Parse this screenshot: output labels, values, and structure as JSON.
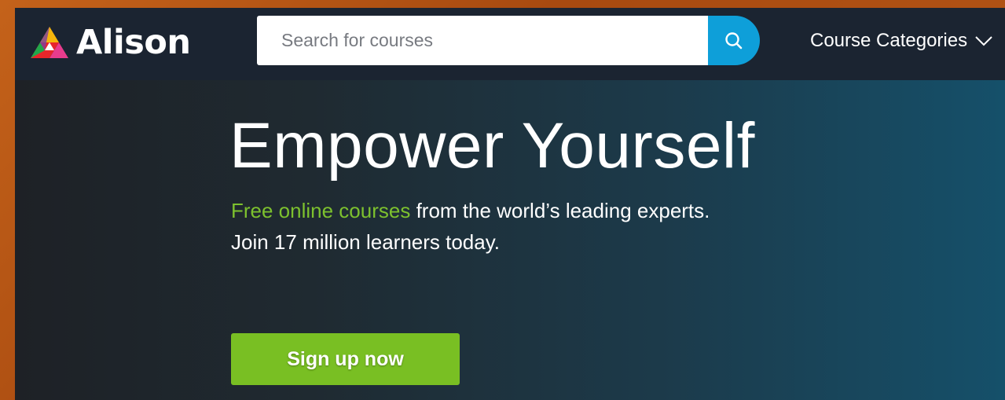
{
  "header": {
    "logo_text": "Alison",
    "logo_icon": "alison-logo-icon",
    "search": {
      "placeholder": "Search for courses",
      "value": "",
      "button_icon": "search-icon"
    },
    "categories_label": "Course Categories",
    "categories_icon": "chevron-down-icon"
  },
  "hero": {
    "title": "Empower Yourself",
    "subtitle_accent": "Free online courses",
    "subtitle_rest": " from the world’s leading experts.",
    "subtitle_line2": "Join 17 million learners today.",
    "cta_label": "Sign up now"
  },
  "colors": {
    "accent_green": "#79bf23",
    "search_blue": "#0e9fd9",
    "header_bg": "#1b2431"
  }
}
